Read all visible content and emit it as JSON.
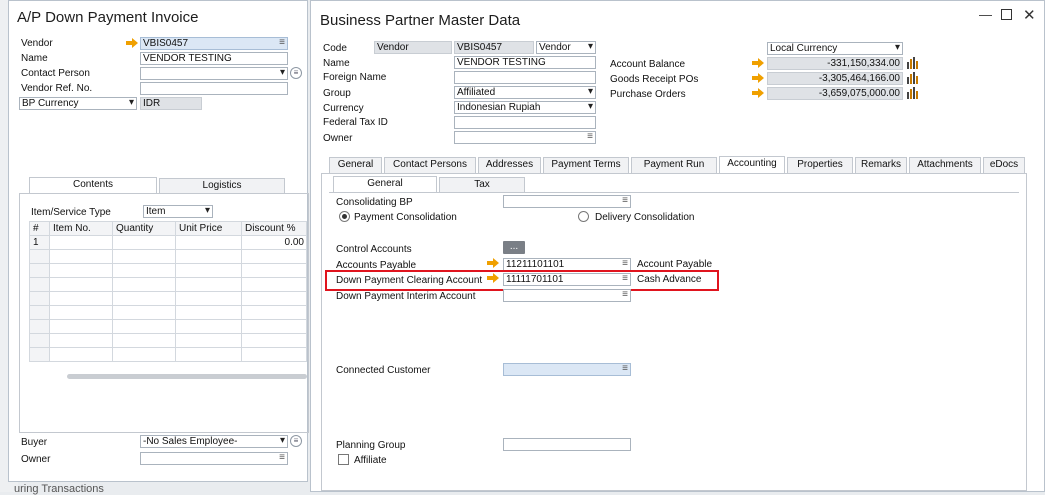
{
  "ap": {
    "title": "A/P Down Payment Invoice",
    "vendor_label": "Vendor",
    "vendor_value": "VBIS0457",
    "name_label": "Name",
    "name_value": "VENDOR TESTING",
    "contact_label": "Contact Person",
    "ref_label": "Vendor Ref. No.",
    "currency_select": "BP Currency",
    "currency_value": "IDR",
    "tabs": [
      "Contents",
      "Logistics"
    ],
    "item_type_label": "Item/Service Type",
    "item_type_value": "Item",
    "columns": [
      "#",
      "Item No.",
      "Quantity",
      "Unit Price",
      "Discount %"
    ],
    "row1": [
      "1",
      "",
      "",
      "",
      "0.00"
    ],
    "buyer_label": "Buyer",
    "buyer_value": "-No Sales Employee-",
    "owner_label": "Owner",
    "bg_text": "uring Transactions"
  },
  "bp": {
    "title": "Business Partner Master Data",
    "code_label": "Code",
    "code_type": "Vendor",
    "code_value": "VBIS0457",
    "code_select": "Vendor",
    "name_label": "Name",
    "name_value": "VENDOR TESTING",
    "foreign_label": "Foreign Name",
    "group_label": "Group",
    "group_value": "Affiliated",
    "currency_label": "Currency",
    "currency_value": "Indonesian Rupiah",
    "tax_label": "Federal Tax ID",
    "owner_label": "Owner",
    "currency_display": "Local Currency",
    "balance_label": "Account Balance",
    "balance_value": "-331,150,334.00",
    "grpo_label": "Goods Receipt POs",
    "grpo_value": "-3,305,464,166.00",
    "po_label": "Purchase Orders",
    "po_value": "-3,659,075,000.00",
    "tabs": [
      "General",
      "Contact Persons",
      "Addresses",
      "Payment Terms",
      "Payment Run",
      "Accounting",
      "Properties",
      "Remarks",
      "Attachments",
      "eDocs"
    ],
    "subtabs": [
      "General",
      "Tax"
    ],
    "consolidating_label": "Consolidating BP",
    "radio_payment": "Payment Consolidation",
    "radio_delivery": "Delivery Consolidation",
    "control_label": "Control Accounts",
    "control_btn": "...",
    "ap_label": "Accounts Payable",
    "ap_value": "11211101101",
    "ap_desc": "Account Payable",
    "dp_label": "Down Payment Clearing Account",
    "dp_value": "11111701101",
    "dp_desc": "Cash Advance",
    "interim_label": "Down Payment Interim Account",
    "customer_label": "Connected Customer",
    "planning_label": "Planning Group",
    "affiliate_label": "Affiliate"
  },
  "colors": {
    "highlight": "#e0141e",
    "arrow": "#f0a000"
  }
}
